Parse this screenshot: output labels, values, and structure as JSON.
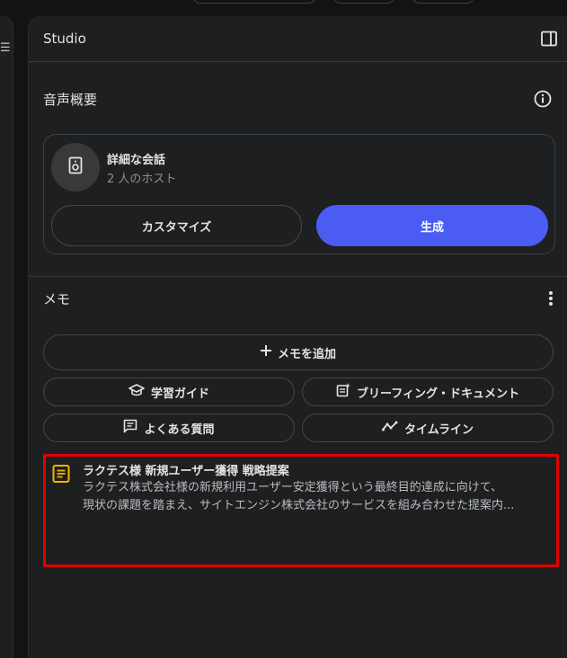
{
  "panel": {
    "title": "Studio"
  },
  "audio_overview": {
    "section_title": "音声概要",
    "card_title": "詳細な会話",
    "card_subtitle": "2 人のホスト",
    "customize_label": "カスタマイズ",
    "generate_label": "生成"
  },
  "notes": {
    "section_title": "メモ",
    "add_note_label": "メモを追加",
    "study_guide_label": "学習ガイド",
    "briefing_label": "ブリーフィング・ドキュメント",
    "faq_label": "よくある質問",
    "timeline_label": "タイムライン",
    "items": [
      {
        "title": "ラクテス様 新規ユーザー獲得 戦略提案",
        "line1": "ラクテス株式会社様の新規利用ユーザー安定獲得という最終目的達成に向けて、",
        "line2": "現状の課題を踏まえ、サイトエンジン株式会社のサービスを組み合わせた提案内..."
      }
    ]
  },
  "colors": {
    "panel_bg": "#1e1f20",
    "accent_primary": "#4b5cf3",
    "note_icon": "#f2b600",
    "highlight_border": "#e30000"
  }
}
